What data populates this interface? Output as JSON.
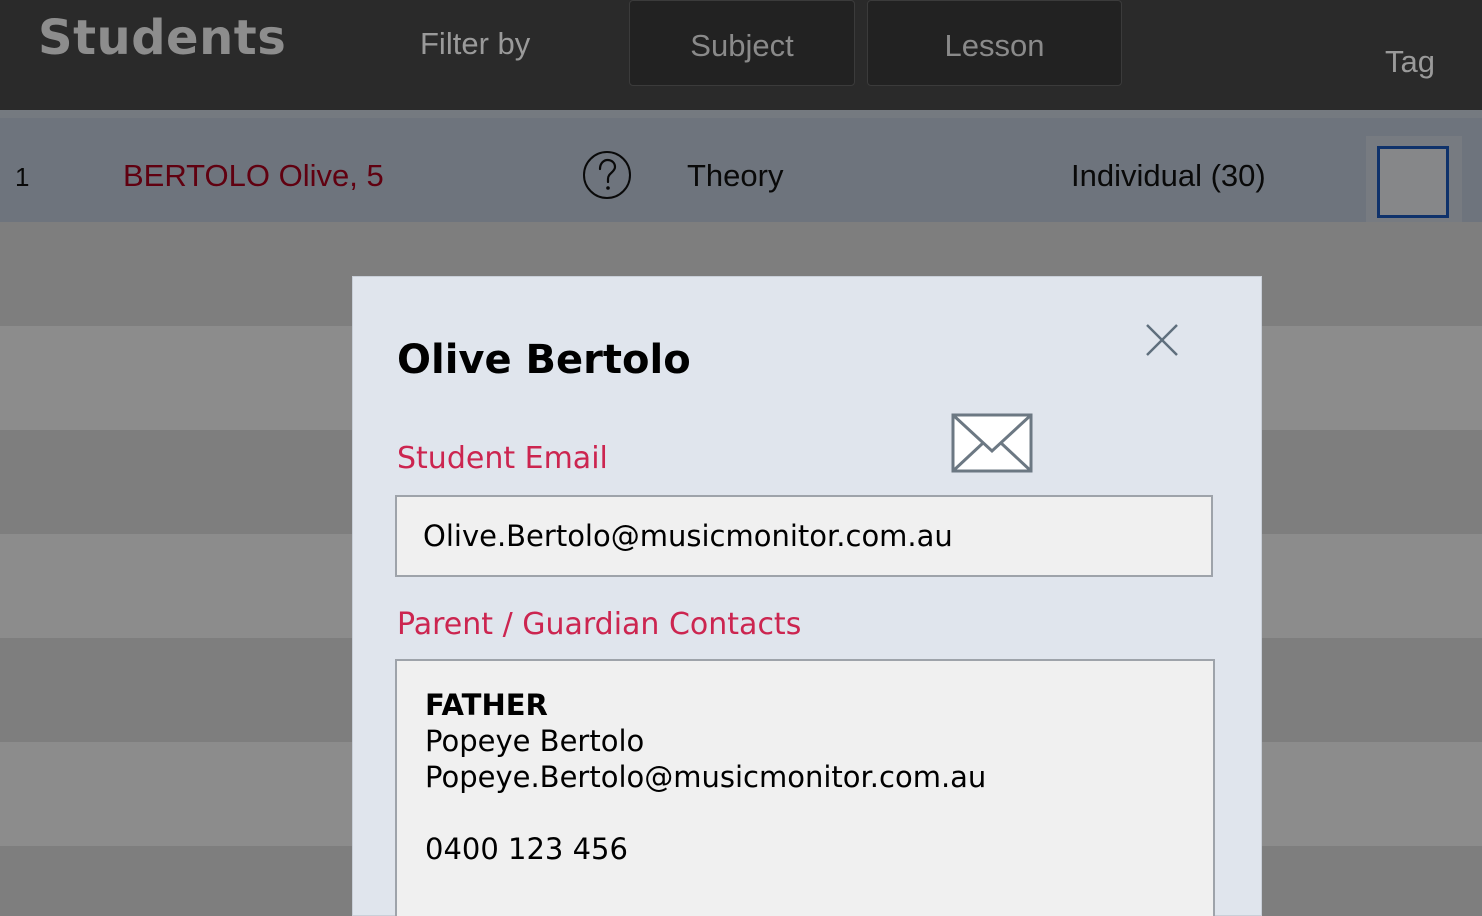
{
  "header": {
    "title": "Students",
    "filter_label": "Filter by",
    "filters": [
      {
        "label": "Subject"
      },
      {
        "label": "Lesson"
      }
    ],
    "tag_label": "Tag"
  },
  "rows": [
    {
      "number": "1",
      "name": "BERTOLO Olive, 5",
      "subject": "Theory",
      "lesson": "Individual (30)",
      "tagged": false
    }
  ],
  "modal": {
    "title": "Olive Bertolo",
    "student_email_label": "Student Email",
    "student_email": "Olive.Bertolo@musicmonitor.com.au",
    "contacts_label": "Parent / Guardian Contacts",
    "contacts": [
      {
        "role": "FATHER",
        "name": "Popeye Bertolo",
        "email": "Popeye.Bertolo@musicmonitor.com.au",
        "phone": "0400 123 456"
      }
    ]
  },
  "colors": {
    "header_bg": "#2a2a2a",
    "student_name": "#b0001e",
    "field_label": "#cc2550",
    "tag_border": "#1d5bc4",
    "modal_bg": "#e0e5ed"
  },
  "icons": [
    "help-icon",
    "close-icon",
    "mail-icon"
  ]
}
